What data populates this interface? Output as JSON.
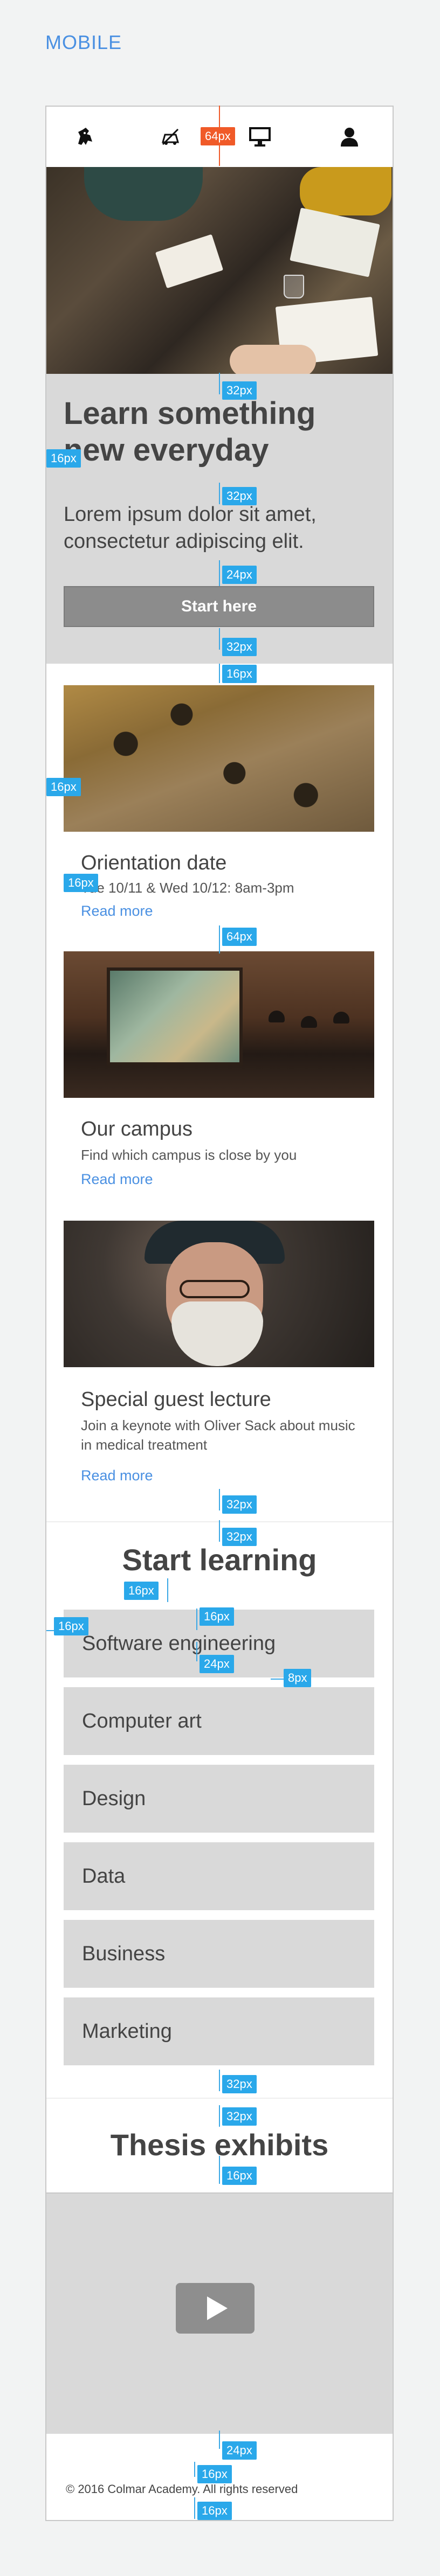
{
  "label": "MOBILE",
  "nav": {
    "icons": [
      "lion-logo-icon",
      "no-car-icon",
      "desktop-icon",
      "user-icon"
    ]
  },
  "hero": {
    "title": "Learn something new everyday",
    "subtitle": "Lorem ipsum dolor sit amet, consectetur adipiscing elit.",
    "button": "Start here"
  },
  "events": [
    {
      "title": "Orientation date",
      "desc": "Tue 10/11 & Wed 10/12: 8am-3pm",
      "link": "Read more"
    },
    {
      "title": "Our campus",
      "desc": "Find which campus is close by you",
      "link": "Read more"
    },
    {
      "title": "Special guest lecture",
      "desc": "Join a keynote with Oliver Sack about music in medical treatment",
      "link": "Read more"
    }
  ],
  "start_learning": {
    "title": "Start learning",
    "courses": [
      "Software engineering",
      "Computer art",
      "Design",
      "Data",
      "Business",
      "Marketing"
    ]
  },
  "thesis": {
    "title": "Thesis exhibits"
  },
  "footer": {
    "text": "© 2016 Colmar Academy. All rights reserved"
  },
  "annotations": {
    "badges": [
      "64px",
      "32px",
      "16px",
      "32px",
      "24px",
      "32px",
      "16px",
      "16px",
      "16px",
      "64px",
      "32px",
      "32px",
      "16px",
      "16px",
      "16px",
      "24px",
      "8px",
      "32px",
      "32px",
      "16px",
      "24px",
      "16px",
      "16px"
    ]
  },
  "colors": {
    "accent": "#4a90e2",
    "annotation": "#2aa8ea",
    "annotation_alt": "#f05a28",
    "panel": "#d9d9d9",
    "button": "#8c8c8c"
  }
}
